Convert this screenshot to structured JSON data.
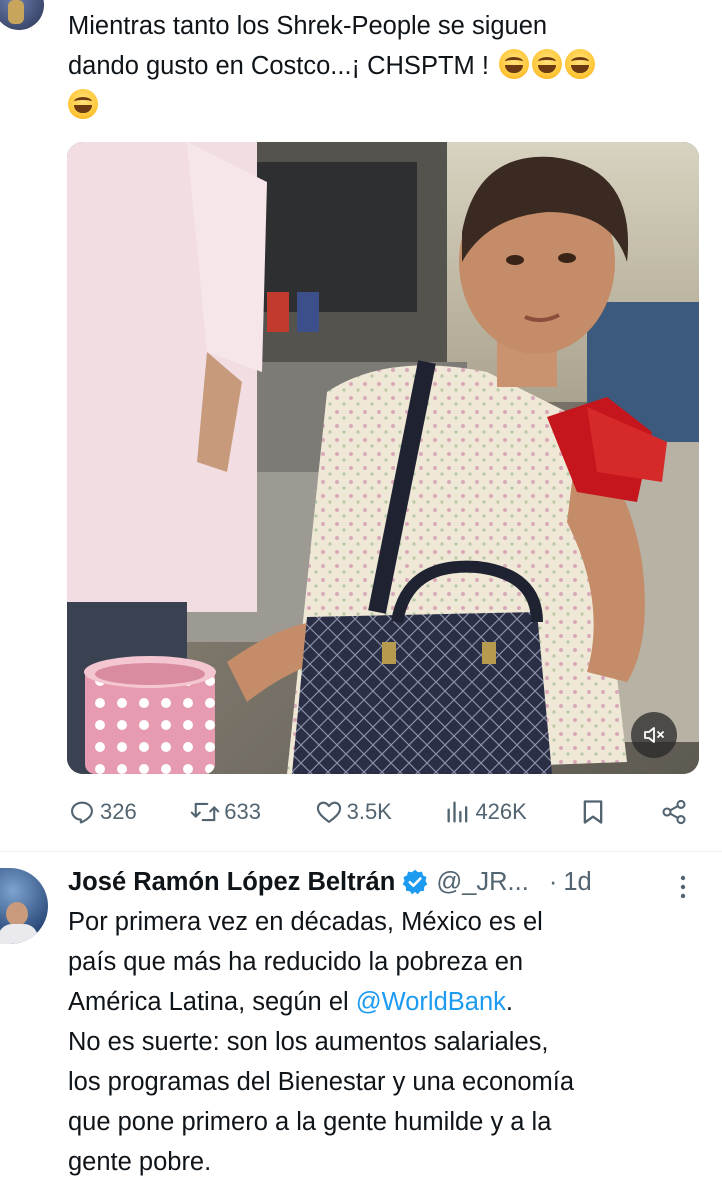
{
  "tweet1": {
    "text_line1": "Mientras tanto los Shrek-People se siguen",
    "text_line2": "dando gusto en Costco...¡ CHSPTM !",
    "emoji_icon": "face-with-tears-of-joy-icon",
    "emoji_count": 4,
    "actions": {
      "replies": "326",
      "reposts": "633",
      "likes": "3.5K",
      "views": "426K"
    }
  },
  "tweet2": {
    "author_name": "José Ramón López Beltrán",
    "handle": "@_JR...",
    "separator": "·",
    "time": "1d",
    "verified_color": "#1d9bf0",
    "text_lines": [
      "Por primera vez en décadas, México es el",
      "país que más ha reducido la pobreza en"
    ],
    "text_line3_prefix": "América Latina, según el ",
    "mention": "@WorldBank",
    "text_line3_suffix": ".",
    "text_lines_rest": [
      "No es suerte: son los aumentos salariales,",
      "los programas del Bienestar y una economía",
      "que pone primero a la gente humilde y a la",
      "gente pobre."
    ]
  },
  "colors": {
    "text": "#0f1419",
    "secondary": "#536471",
    "link": "#1d9bf0",
    "divider": "#eff3f4"
  }
}
